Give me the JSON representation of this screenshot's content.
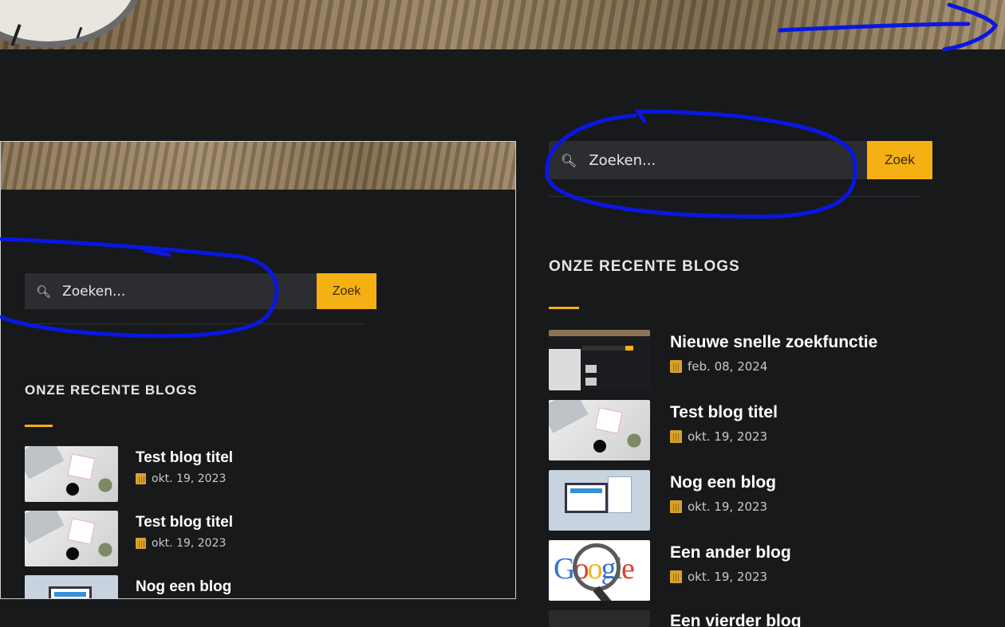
{
  "colors": {
    "accent": "#f5b014",
    "background": "#18191b",
    "annotation": "#0a17e0"
  },
  "right_widget": {
    "search": {
      "placeholder": "Zoeken...",
      "button": "Zoek"
    },
    "section_title": "ONZE RECENTE BLOGS",
    "posts": [
      {
        "title": "Nieuwe snelle zoekfunctie",
        "date": "feb. 08, 2024",
        "thumb": "search-screenshot"
      },
      {
        "title": "Test blog titel",
        "date": "okt. 19, 2023",
        "thumb": "desk"
      },
      {
        "title": "Nog een blog",
        "date": "okt. 19, 2023",
        "thumb": "computer"
      },
      {
        "title": "Een ander blog",
        "date": "okt. 19, 2023",
        "thumb": "google"
      },
      {
        "title": "Een vierder blog",
        "date": "",
        "thumb": "dark"
      }
    ]
  },
  "left_widget": {
    "search": {
      "placeholder": "Zoeken...",
      "button": "Zoek"
    },
    "section_title": "ONZE RECENTE BLOGS",
    "posts": [
      {
        "title": "Test blog titel",
        "date": "okt. 19, 2023",
        "thumb": "desk"
      },
      {
        "title": "Test blog titel",
        "date": "okt. 19, 2023",
        "thumb": "desk"
      },
      {
        "title": "Nog een blog",
        "date": "",
        "thumb": "computer"
      }
    ]
  }
}
